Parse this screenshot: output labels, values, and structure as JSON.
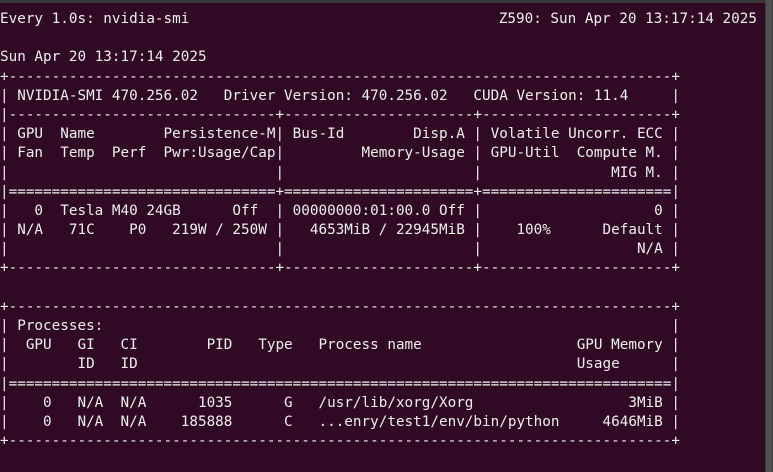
{
  "watch": {
    "left": "Every 1.0s: nvidia-smi",
    "right": "Z590: Sun Apr 20 13:17:14 2025"
  },
  "timestamp": "Sun Apr 20 13:17:14 2025",
  "smi_table": [
    "+-----------------------------------------------------------------------------+",
    "| NVIDIA-SMI 470.256.02   Driver Version: 470.256.02   CUDA Version: 11.4     |",
    "|-------------------------------+----------------------+----------------------+",
    "| GPU  Name        Persistence-M| Bus-Id        Disp.A | Volatile Uncorr. ECC |",
    "| Fan  Temp  Perf  Pwr:Usage/Cap|         Memory-Usage | GPU-Util  Compute M. |",
    "|                               |                      |               MIG M. |",
    "|===============================+======================+======================|",
    "|   0  Tesla M40 24GB      Off  | 00000000:01:00.0 Off |                    0 |",
    "| N/A   71C    P0   219W / 250W |   4653MiB / 22945MiB |    100%      Default |",
    "|                               |                      |                  N/A |",
    "+-------------------------------+----------------------+----------------------+",
    "",
    "+-----------------------------------------------------------------------------+",
    "| Processes:                                                                  |",
    "|  GPU   GI   CI        PID   Type   Process name                  GPU Memory |",
    "|        ID   ID                                                   Usage      |",
    "|=============================================================================|",
    "|    0   N/A  N/A      1035      G   /usr/lib/xorg/Xorg                  3MiB |",
    "|    0   N/A  N/A    185888      C   ...enry/test1/env/bin/python     4646MiB |",
    "+-----------------------------------------------------------------------------+"
  ],
  "colors": {
    "terminal_bg": "#300a24",
    "terminal_fg": "#eeeeec"
  }
}
